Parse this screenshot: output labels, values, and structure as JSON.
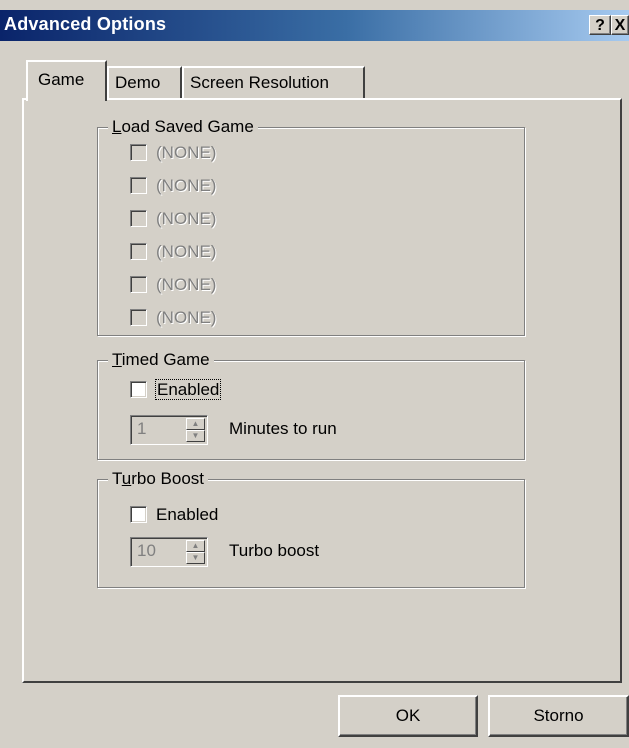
{
  "window": {
    "title": "Advanced Options",
    "help_label": "?",
    "close_label": "X"
  },
  "tabs": [
    {
      "label": "Game",
      "active": true
    },
    {
      "label": "Demo",
      "active": false
    },
    {
      "label": "Screen Resolution",
      "active": false
    }
  ],
  "load_saved_game": {
    "title_first": "L",
    "title_rest": "oad Saved Game",
    "items": [
      {
        "label": "(NONE)",
        "checked": false,
        "enabled": false
      },
      {
        "label": "(NONE)",
        "checked": false,
        "enabled": false
      },
      {
        "label": "(NONE)",
        "checked": false,
        "enabled": false
      },
      {
        "label": "(NONE)",
        "checked": false,
        "enabled": false
      },
      {
        "label": "(NONE)",
        "checked": false,
        "enabled": false
      },
      {
        "label": "(NONE)",
        "checked": false,
        "enabled": false
      }
    ]
  },
  "timed_game": {
    "title_first": "T",
    "title_rest": "imed Game",
    "enabled_label": "Enabled",
    "enabled_checked": false,
    "spin_value": "1",
    "spin_label": "Minutes to run"
  },
  "turbo_boost": {
    "title_prefix": "T",
    "title_ul": "u",
    "title_rest": "rbo Boost",
    "enabled_label": "Enabled",
    "enabled_checked": false,
    "spin_value": "10",
    "spin_label": "Turbo boost"
  },
  "buttons": {
    "ok": "OK",
    "cancel": "Storno"
  }
}
